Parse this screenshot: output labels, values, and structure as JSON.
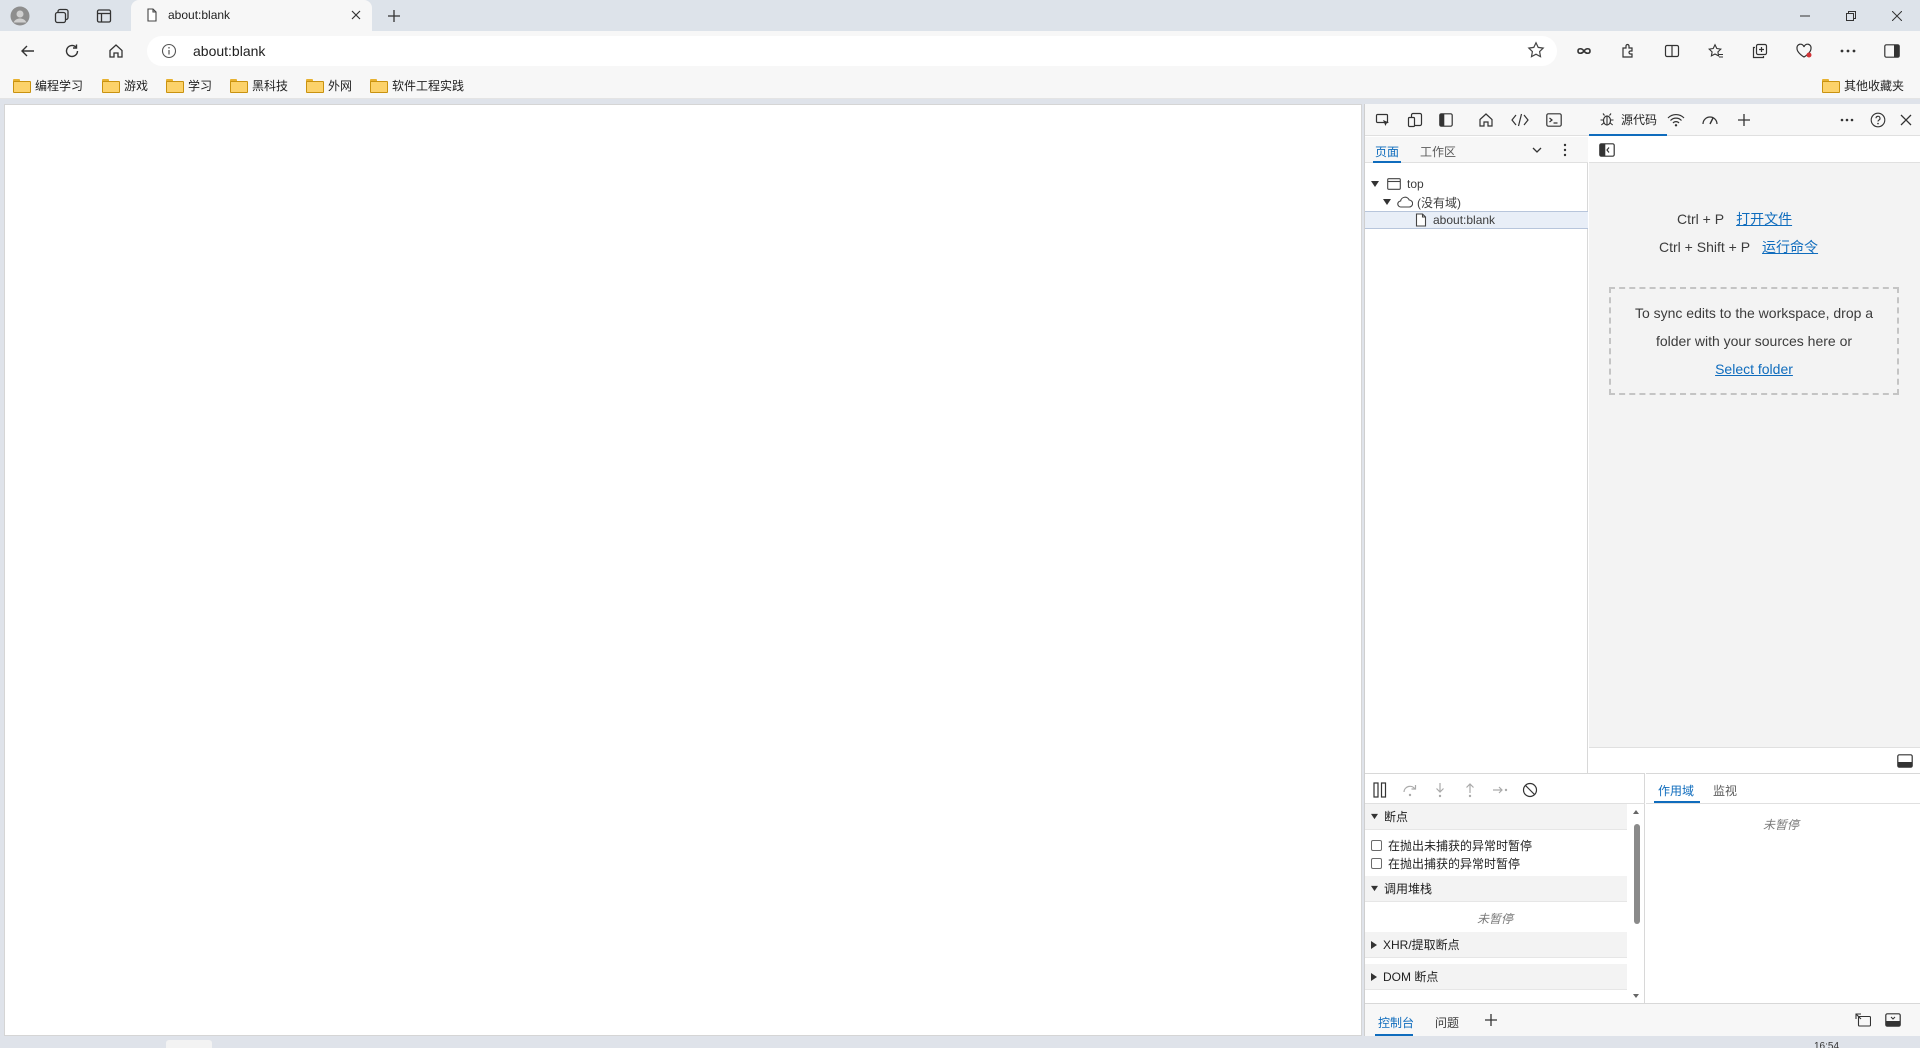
{
  "browser": {
    "tab": {
      "title": "about:blank",
      "favicon": "page-icon"
    },
    "address": {
      "value": "about:blank",
      "icon": "info-icon"
    },
    "tabbar_icons": [
      "profile-icon",
      "workspaces-icon",
      "vertical-tabs-icon"
    ],
    "toolbar_icons": [
      "infinity-icon",
      "extensions-icon",
      "split-screen-icon",
      "favorites-icon",
      "collections-icon",
      "browser-essentials-icon",
      "more-icon",
      "sidebar-icon"
    ],
    "bookmarks": [
      "编程学习",
      "游戏",
      "学习",
      "黑科技",
      "外网",
      "软件工程实践"
    ],
    "other_bookmarks": "其他收藏夹"
  },
  "devtools": {
    "active_tool": "源代码",
    "navigator": {
      "tabs": [
        "页面",
        "工作区"
      ],
      "tree": [
        {
          "label": "top",
          "icon": "frame-icon",
          "level": 0
        },
        {
          "label": "(没有域)",
          "icon": "cloud-icon",
          "level": 1
        },
        {
          "label": "about:blank",
          "icon": "file-icon",
          "level": 2
        }
      ]
    },
    "editor": {
      "shortcut1_keys": "Ctrl + P",
      "shortcut1_action": "打开文件",
      "shortcut2_keys": "Ctrl + Shift + P",
      "shortcut2_action": "运行命令",
      "drop_text": "To sync edits to the workspace, drop a folder with your sources here or",
      "select_folder": "Select folder"
    },
    "debugger": {
      "breakpoints_title": "断点",
      "pause_uncaught": "在抛出未捕获的异常时暂停",
      "pause_caught": "在抛出捕获的异常时暂停",
      "callstack_title": "调用堆栈",
      "not_paused": "未暂停",
      "xhr_title": "XHR/提取断点",
      "dom_title": "DOM 断点"
    },
    "scope": {
      "tabs": [
        "作用域",
        "监视"
      ],
      "not_paused": "未暂停"
    },
    "drawer": {
      "tabs": [
        "控制台",
        "问题"
      ]
    }
  },
  "taskbar": {
    "clock_partial": "16:54"
  },
  "colors": {
    "accent": "#0f6cbd",
    "folder": "#fcd26a"
  }
}
